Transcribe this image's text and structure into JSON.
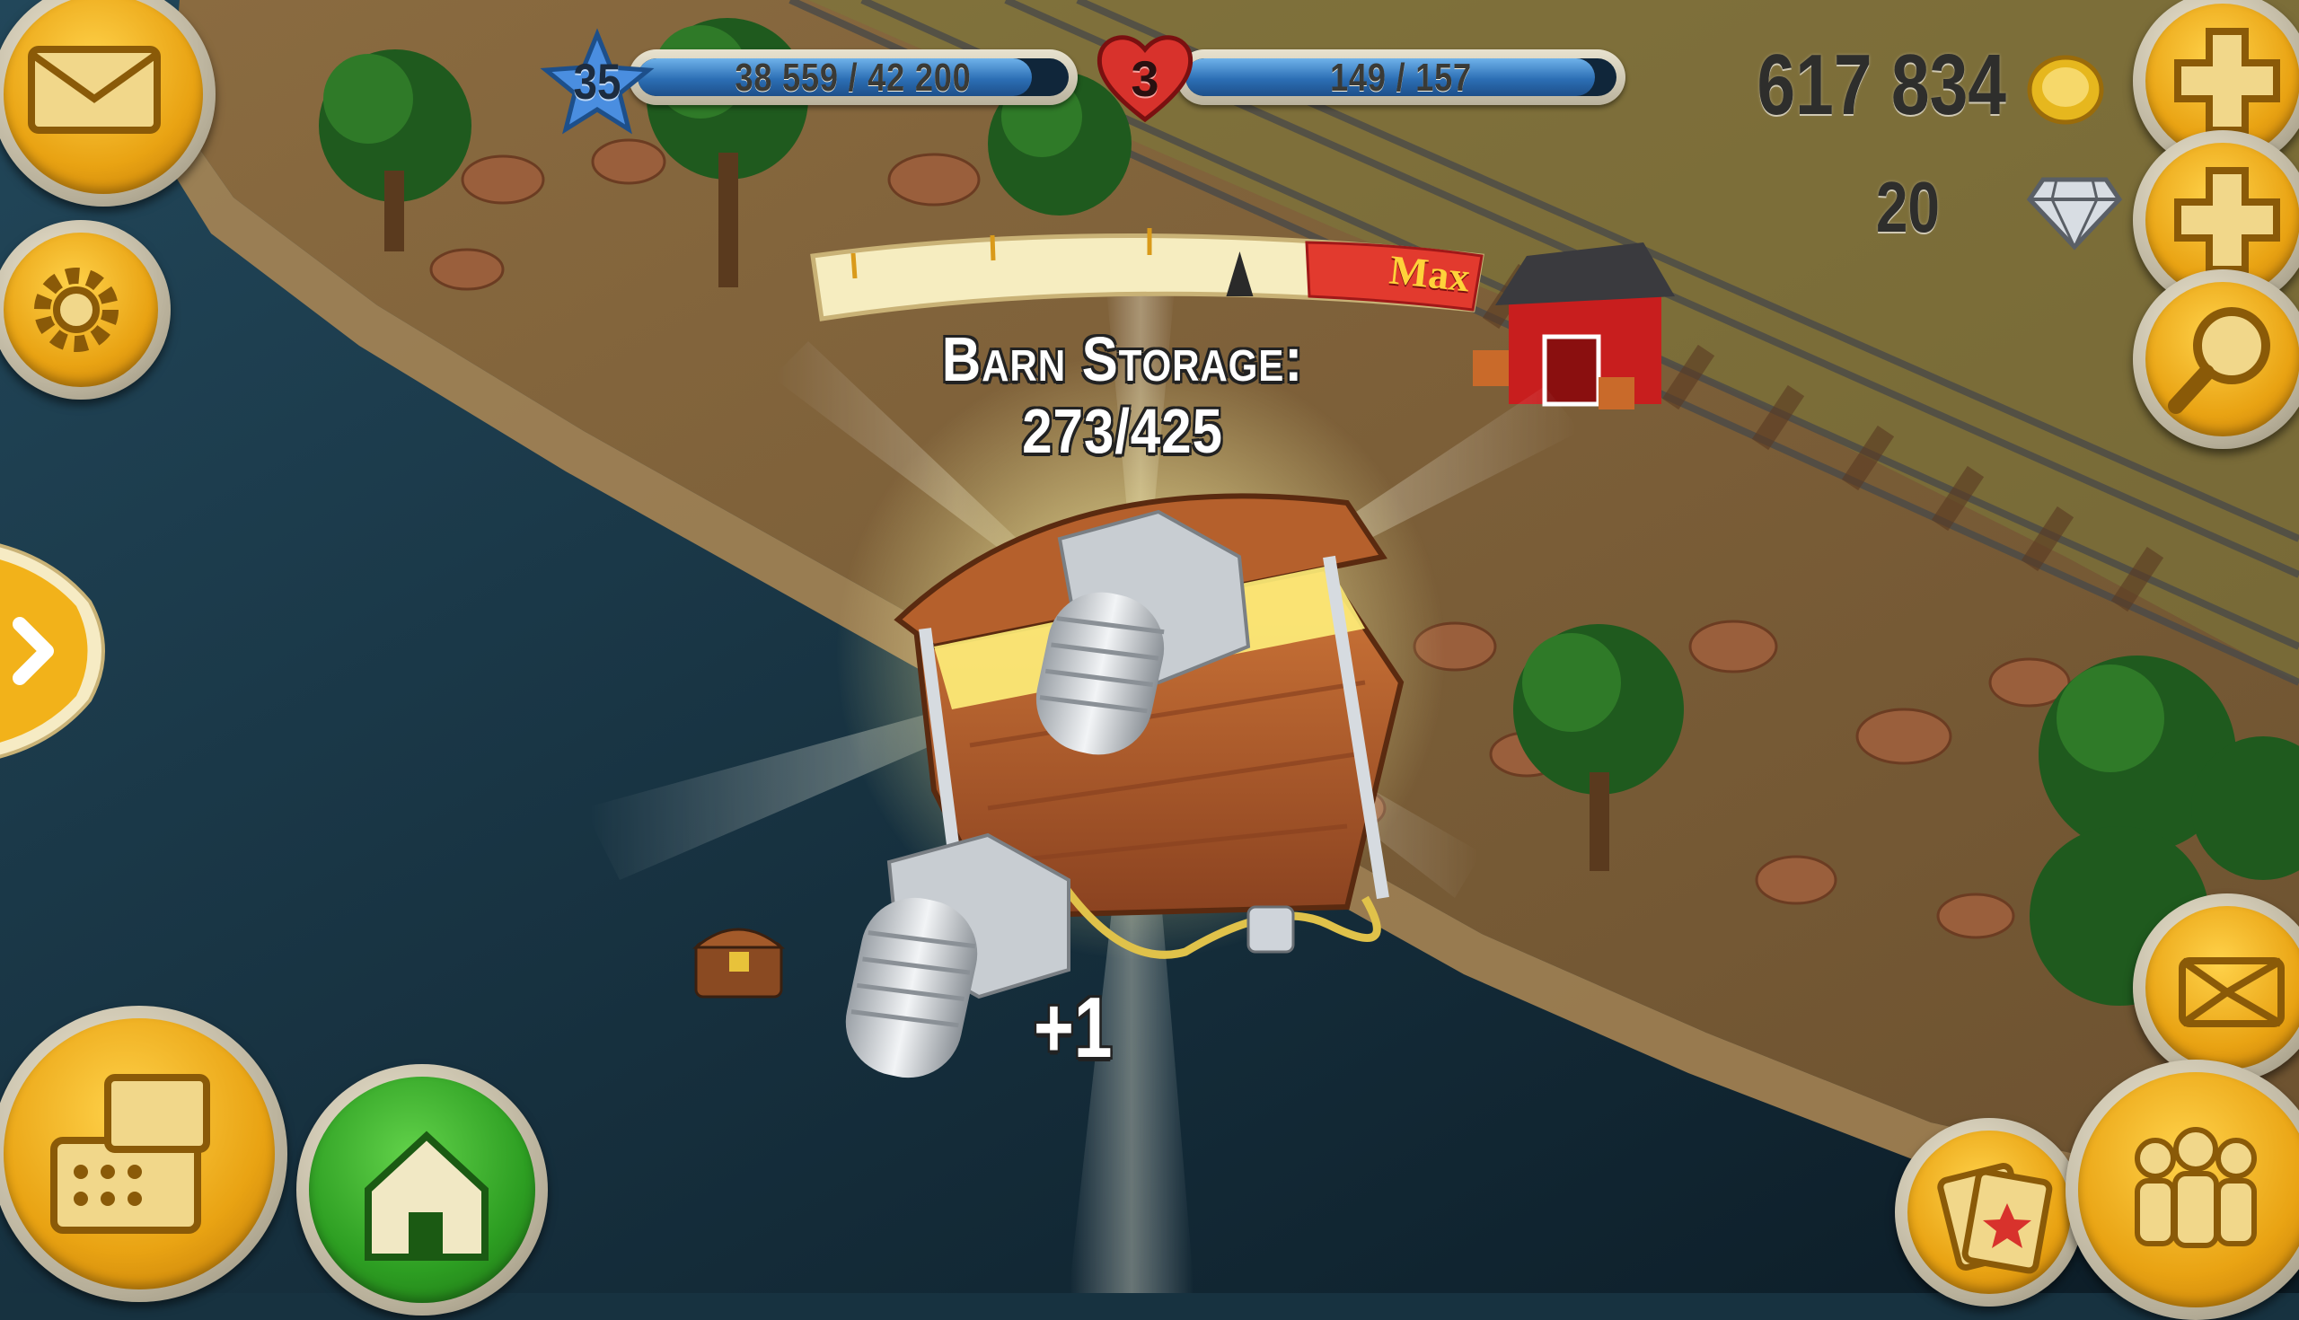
{
  "hud": {
    "level": "35",
    "xp_text": "38 559 / 42 200",
    "xp_progress": 0.914,
    "hearts": "3",
    "hearts_text": "149 / 157",
    "hearts_progress": 0.949,
    "coins": "617 834",
    "diamonds": "20"
  },
  "popup": {
    "storage_label": "Barn Storage: 273/425",
    "storage_fraction": 0.642,
    "max_label": "Max",
    "reward_text": "+1",
    "reward_item": "bolt-icon"
  },
  "icons": {
    "mail": "mail-icon",
    "settings": "gear-icon",
    "expand": "chevron-right-icon",
    "shop": "cash-register-icon",
    "home": "home-icon",
    "add_coins": "plus-icon",
    "add_diamonds": "plus-icon",
    "search": "magnifier-icon",
    "fullscreen": "expand-arrows-icon",
    "cards": "cards-icon",
    "friends": "friends-icon"
  },
  "colors": {
    "accent_gold": "#e9a313",
    "home_green": "#2d9e22",
    "bar_blue": "#2c6fb5",
    "meter_red": "#e23a2e"
  }
}
